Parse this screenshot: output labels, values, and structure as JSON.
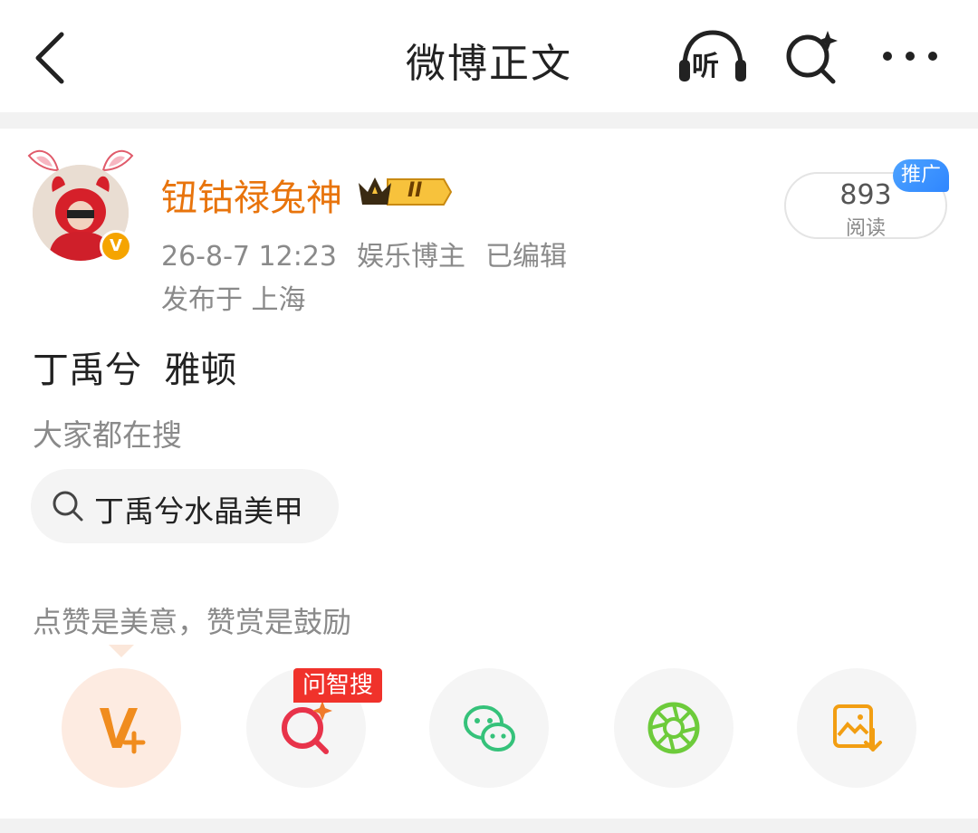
{
  "header": {
    "title": "微博正文",
    "listen_label": "听",
    "icons": [
      "back-arrow-icon",
      "headphones-icon",
      "ai-search-icon",
      "more-icon"
    ]
  },
  "author": {
    "name": "钮钴禄兔神",
    "badge_text": "II",
    "verified_mark": "V",
    "time": "26-8-7 12:23",
    "category": "娱乐博主",
    "edited": "已编辑",
    "location": "发布于 上海",
    "reads": {
      "count": "893",
      "label": "阅读",
      "promo_tag": "推广"
    }
  },
  "post": {
    "content": "丁禹兮  雅顿"
  },
  "hot_search": {
    "label": "大家都在搜",
    "chip": "丁禹兮水晶美甲"
  },
  "actions": {
    "reward_prompt": "点赞是美意，赞赏是鼓励",
    "ai_tag": "问智搜",
    "buttons": [
      "reward-icon",
      "ai-search-icon",
      "wechat-icon",
      "moments-icon",
      "save-image-icon"
    ]
  },
  "colors": {
    "username": "#e8740c",
    "promo": "#2f86ff",
    "ai_tag": "#f0322b",
    "wechat": "#35c27a",
    "moments": "#6dcb3b",
    "save": "#f29e12"
  }
}
